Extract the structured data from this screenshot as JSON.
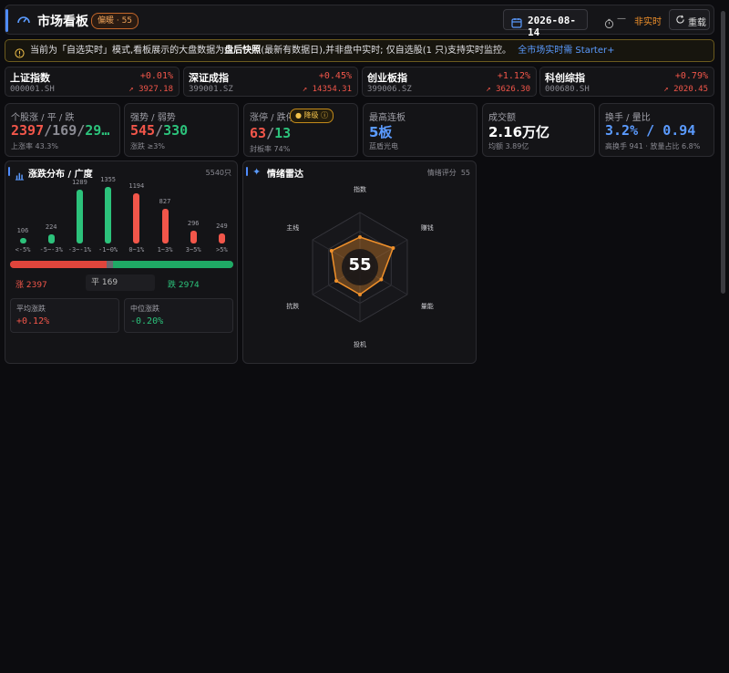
{
  "header": {
    "title": "市场看板",
    "sentiment_badge": "偏暖 · 55",
    "date": "2026-08-14",
    "timer_text": "—",
    "realtime_status": "非实时",
    "refresh_label": "重载"
  },
  "notice": {
    "prefix": "当前为「自选实时」模式,看板展示的大盘数据为",
    "highlight": "盘后快照",
    "suffix": "(最新有数据日),并非盘中实时; 仅自选股(1 只)支持实时监控。",
    "link": "全市场实时需 Starter+"
  },
  "indices": [
    {
      "name": "上证指数",
      "code": "000001.SH",
      "change": "+0.01%",
      "price": "3927.18"
    },
    {
      "name": "深证成指",
      "code": "399001.SZ",
      "change": "+0.45%",
      "price": "14354.31"
    },
    {
      "name": "创业板指",
      "code": "399006.SZ",
      "change": "+1.12%",
      "price": "3626.30"
    },
    {
      "name": "科创综指",
      "code": "000680.SH",
      "change": "+0.79%",
      "price": "2020.45"
    }
  ],
  "stats": {
    "breadth": {
      "label": "个股涨 / 平 / 跌",
      "up": "2397",
      "flat": "169",
      "down": "29…",
      "sub": "上涨率 43.3%"
    },
    "strength": {
      "label": "强势 / 弱势",
      "strong": "545",
      "weak": "330",
      "sub": "涨跌 ≥3%"
    },
    "limit": {
      "label": "涨停 / 跌停",
      "pill": "降级",
      "up": "63",
      "down": "13",
      "sub": "封板率 74%"
    },
    "streak": {
      "label": "最高连板",
      "value": "5板",
      "sub": "蓝盾光电"
    },
    "turnover": {
      "label": "成交额",
      "value": "2.16万亿",
      "sub": "均额 3.89亿"
    },
    "rate": {
      "label": "换手 / 量比",
      "value": "3.2% / 0.94",
      "sub": "高换手 941 · 放量占比 6.8%"
    }
  },
  "distribution": {
    "title": "涨跌分布 / 广度",
    "total": "5540只",
    "up_label": "涨 2397",
    "flat_label": "平 169",
    "down_label": "跌 2974",
    "avg_label": "平均涨跌",
    "avg_value": "+0.12%",
    "median_label": "中位涨跌",
    "median_value": "-0.20%",
    "up_share": 0.433,
    "flat_share": 0.03,
    "down_share": 0.537
  },
  "chart_data": {
    "type": "bar",
    "categories": [
      "<-5%",
      "-5~-3%",
      "-3~-1%",
      "-1~0%",
      "0~1%",
      "1~3%",
      "3~5%",
      ">5%"
    ],
    "values": [
      106,
      224,
      1289,
      1355,
      1194,
      827,
      296,
      249
    ],
    "colors": [
      "#2cc27b",
      "#2cc27b",
      "#2cc27b",
      "#2cc27b",
      "#f2564a",
      "#f2564a",
      "#f2564a",
      "#f2564a"
    ]
  },
  "radar": {
    "title": "情绪雷达",
    "score_label": "情绪评分",
    "score": "55",
    "axes": [
      "指数",
      "赚钱",
      "量能",
      "投机",
      "抗跌",
      "主线"
    ],
    "values": [
      0.55,
      0.7,
      0.45,
      0.5,
      0.5,
      0.6
    ]
  },
  "colors": {
    "up": "#f2564a",
    "down": "#2cc27b",
    "accent": "#4f8cff",
    "radar": "#f0902a"
  }
}
